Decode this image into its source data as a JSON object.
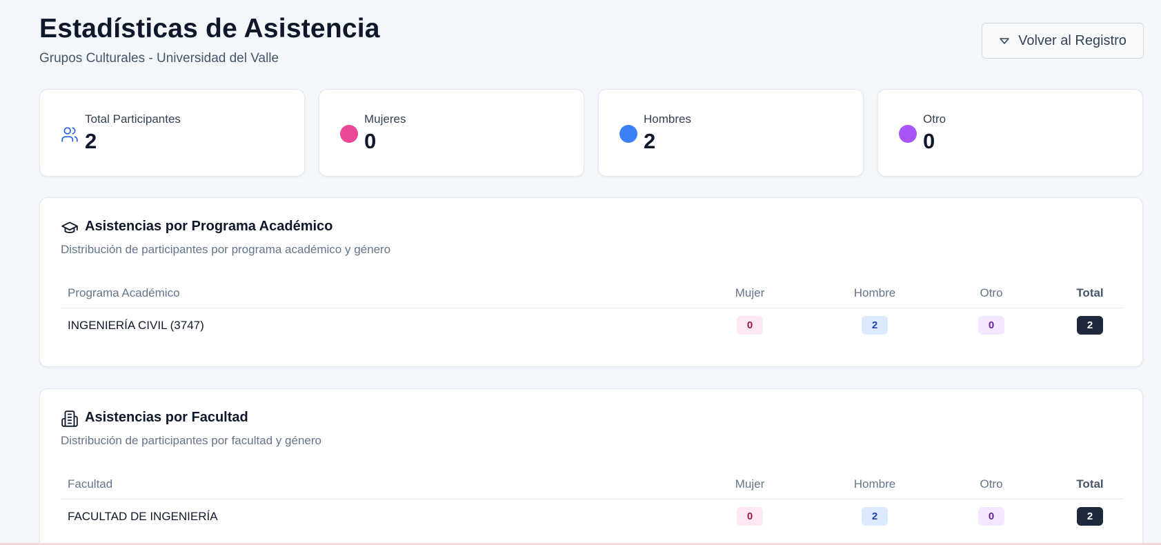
{
  "header": {
    "title": "Estadísticas de Asistencia",
    "subtitle": "Grupos Culturales - Universidad del Valle",
    "back_button": "Volver al Registro"
  },
  "stats": [
    {
      "label": "Total Participantes",
      "value": "2",
      "icon": "users-icon",
      "color": "#2563eb"
    },
    {
      "label": "Mujeres",
      "value": "0",
      "icon": "dot",
      "color": "#ec4899"
    },
    {
      "label": "Hombres",
      "value": "2",
      "icon": "dot",
      "color": "#3b82f6"
    },
    {
      "label": "Otro",
      "value": "0",
      "icon": "dot",
      "color": "#a855f7"
    }
  ],
  "programs": {
    "title": "Asistencias por Programa Académico",
    "description": "Distribución de participantes por programa académico y género",
    "icon": "graduation-cap-icon",
    "columns": [
      "Programa Académico",
      "Mujer",
      "Hombre",
      "Otro",
      "Total"
    ],
    "rows": [
      {
        "name": "INGENIERÍA CIVIL (3747)",
        "mujer": "0",
        "hombre": "2",
        "otro": "0",
        "total": "2"
      }
    ]
  },
  "faculties": {
    "title": "Asistencias por Facultad",
    "description": "Distribución de participantes por facultad y género",
    "icon": "building-icon",
    "columns": [
      "Facultad",
      "Mujer",
      "Hombre",
      "Otro",
      "Total"
    ],
    "rows": [
      {
        "name": "FACULTAD DE INGENIERÍA",
        "mujer": "0",
        "hombre": "2",
        "otro": "0",
        "total": "2"
      }
    ]
  }
}
